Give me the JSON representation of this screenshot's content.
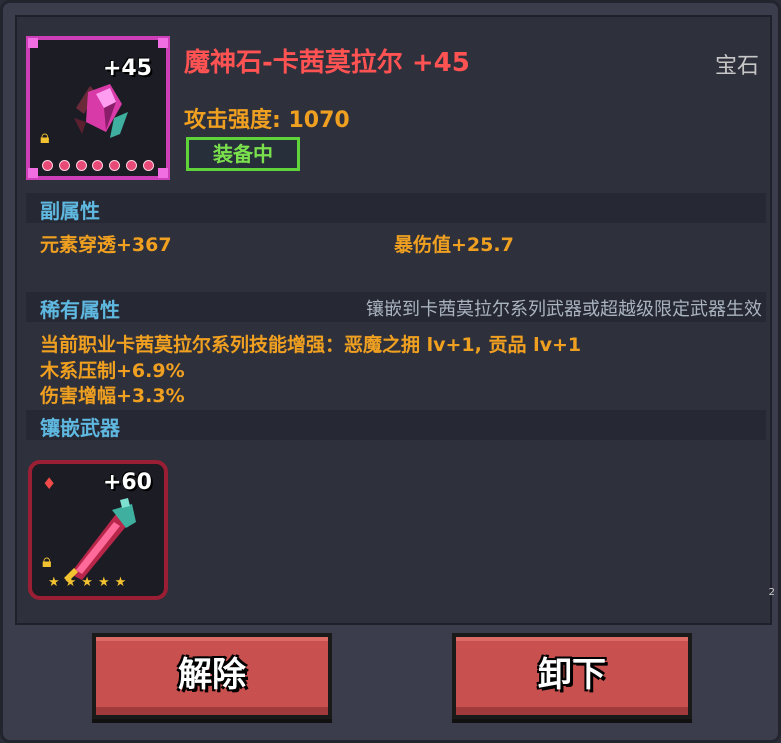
{
  "item": {
    "name": "魔神石-卡茜莫拉尔 +45",
    "level": "+45",
    "category": "宝石",
    "attack": "攻击强度: 1070",
    "equipped_badge": "装备中",
    "icon": "gem-icon",
    "colors": {
      "border": "#cc3fb6",
      "name": "#ff5252"
    }
  },
  "sub_attributes": {
    "label": "副属性",
    "stats": [
      "元素穿透+367",
      "暴伤值+25.7"
    ]
  },
  "rare_attributes": {
    "label": "稀有属性",
    "note": "镶嵌到卡茜莫拉尔系列武器或超越级限定武器生效",
    "lines": [
      "当前职业卡茜莫拉尔系列技能增强：恶魔之拥 lv+1, 贡品 lv+1",
      "木系压制+6.9%",
      "伤害增幅+3.3%"
    ]
  },
  "inlay": {
    "label": "镶嵌武器",
    "weapon_level": "+60",
    "weapon_icon": "sword-icon",
    "stars": 5
  },
  "page_indicator": "2",
  "buttons": {
    "unset": "解除",
    "remove": "卸下"
  }
}
